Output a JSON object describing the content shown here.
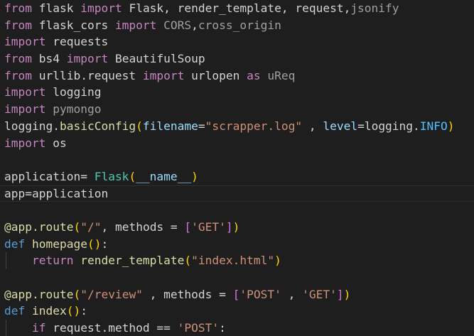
{
  "editor": {
    "lines": [
      [
        [
          "kw",
          "from"
        ],
        [
          "txt",
          " flask "
        ],
        [
          "kw",
          "import"
        ],
        [
          "txt",
          " Flask, render_template, request,"
        ],
        [
          "dim",
          "jsonify"
        ]
      ],
      [
        [
          "kw",
          "from"
        ],
        [
          "txt",
          " flask_cors "
        ],
        [
          "kw",
          "import"
        ],
        [
          "dim",
          " CORS"
        ],
        [
          "txt",
          ","
        ],
        [
          "dim",
          "cross_origin"
        ]
      ],
      [
        [
          "kw",
          "import"
        ],
        [
          "txt",
          " requests"
        ]
      ],
      [
        [
          "kw",
          "from"
        ],
        [
          "txt",
          " bs4 "
        ],
        [
          "kw",
          "import"
        ],
        [
          "txt",
          " BeautifulSoup"
        ]
      ],
      [
        [
          "kw",
          "from"
        ],
        [
          "txt",
          " urllib.request "
        ],
        [
          "kw",
          "import"
        ],
        [
          "txt",
          " urlopen "
        ],
        [
          "kw",
          "as"
        ],
        [
          "dim",
          " uReq"
        ]
      ],
      [
        [
          "kw",
          "import"
        ],
        [
          "txt",
          " logging"
        ]
      ],
      [
        [
          "kw",
          "import"
        ],
        [
          "dim",
          " pymongo"
        ]
      ],
      [
        [
          "txt",
          "logging."
        ],
        [
          "fn",
          "basicConfig"
        ],
        [
          "p1",
          "("
        ],
        [
          "var",
          "filename"
        ],
        [
          "txt",
          "="
        ],
        [
          "str",
          "\"scrapper.log\""
        ],
        [
          "txt",
          " , "
        ],
        [
          "var",
          "level"
        ],
        [
          "txt",
          "=logging."
        ],
        [
          "const",
          "INFO"
        ],
        [
          "p1",
          ")"
        ]
      ],
      [
        [
          "kw",
          "import"
        ],
        [
          "txt",
          " os"
        ]
      ],
      [],
      [
        [
          "txt",
          "application= "
        ],
        [
          "cls",
          "Flask"
        ],
        [
          "p1",
          "("
        ],
        [
          "var",
          "__name__"
        ],
        [
          "p1",
          ")"
        ]
      ],
      [
        [
          "txt",
          "app=application"
        ]
      ],
      [],
      [
        [
          "fn",
          "@app.route"
        ],
        [
          "p1",
          "("
        ],
        [
          "str",
          "\"/\""
        ],
        [
          "txt",
          ", methods = "
        ],
        [
          "p2",
          "["
        ],
        [
          "str",
          "'GET'"
        ],
        [
          "p2",
          "]"
        ],
        [
          "p1",
          ")"
        ]
      ],
      [
        [
          "def",
          "def"
        ],
        [
          "fn",
          " homepage"
        ],
        [
          "p1",
          "("
        ],
        [
          "p1",
          ")"
        ],
        [
          "txt",
          ":"
        ]
      ],
      [
        [
          "txt",
          "    "
        ],
        [
          "kw",
          "return"
        ],
        [
          "fn",
          " render_template"
        ],
        [
          "p1",
          "("
        ],
        [
          "str",
          "\"index.html\""
        ],
        [
          "p1",
          ")"
        ]
      ],
      [],
      [
        [
          "fn",
          "@app.route"
        ],
        [
          "p1",
          "("
        ],
        [
          "str",
          "\"/review\""
        ],
        [
          "txt",
          " , methods = "
        ],
        [
          "p2",
          "["
        ],
        [
          "str",
          "'POST'"
        ],
        [
          "txt",
          " , "
        ],
        [
          "str",
          "'GET'"
        ],
        [
          "p2",
          "]"
        ],
        [
          "p1",
          ")"
        ]
      ],
      [
        [
          "def",
          "def"
        ],
        [
          "fn",
          " index"
        ],
        [
          "p1",
          "("
        ],
        [
          "p1",
          ")"
        ],
        [
          "txt",
          ":"
        ]
      ],
      [
        [
          "txt",
          "    "
        ],
        [
          "kw",
          "if"
        ],
        [
          "txt",
          " request.method == "
        ],
        [
          "str",
          "'POST'"
        ],
        [
          "txt",
          ":"
        ]
      ]
    ]
  }
}
